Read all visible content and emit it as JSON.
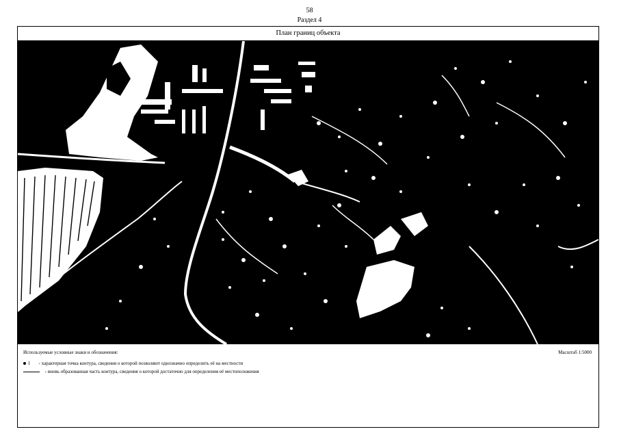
{
  "header": {
    "page_number": "58",
    "section": "Раздел 4"
  },
  "plan": {
    "title": "План границ объекта"
  },
  "legend": {
    "title": "Используемые условные знаки и обозначения:",
    "scale": "Масштаб 1:5000",
    "point_marker": "1",
    "point_text": "- характерная точка контура, сведения о которой позволяют однозначно определить её на местности",
    "line_text": "- вновь образованная часть контура, сведения о которой достаточно для определения её местоположения"
  }
}
